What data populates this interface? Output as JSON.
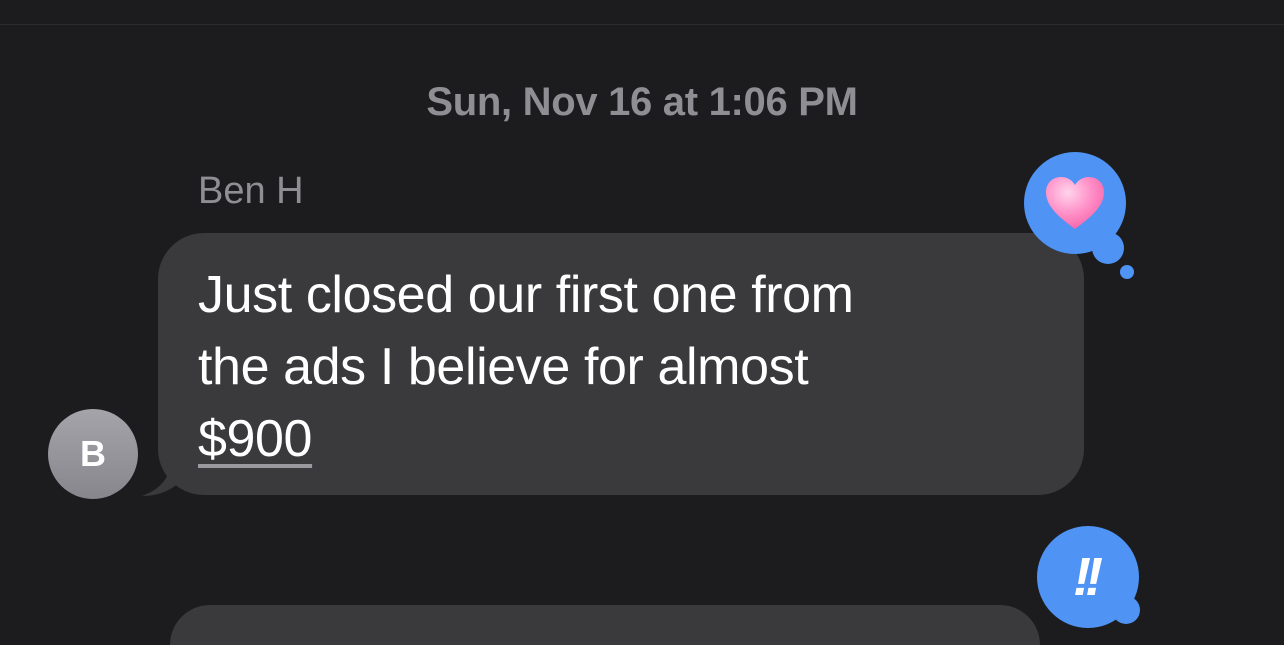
{
  "header": {
    "timestamp": "Sun, Nov 16 at 1:06 PM"
  },
  "message": {
    "sender_name": "Ben H",
    "avatar_initial": "B",
    "text_line1": "Just closed our first one from",
    "text_line2": "the ads I believe for almost",
    "link_text": "$900"
  },
  "reactions": {
    "heart": "heart-reaction",
    "emphasis_glyph": "!!"
  },
  "colors": {
    "background": "#1c1c1e",
    "bubble": "#3a3a3c",
    "tapback_blue": "#4f93f5",
    "meta_text": "#8e8e93"
  }
}
